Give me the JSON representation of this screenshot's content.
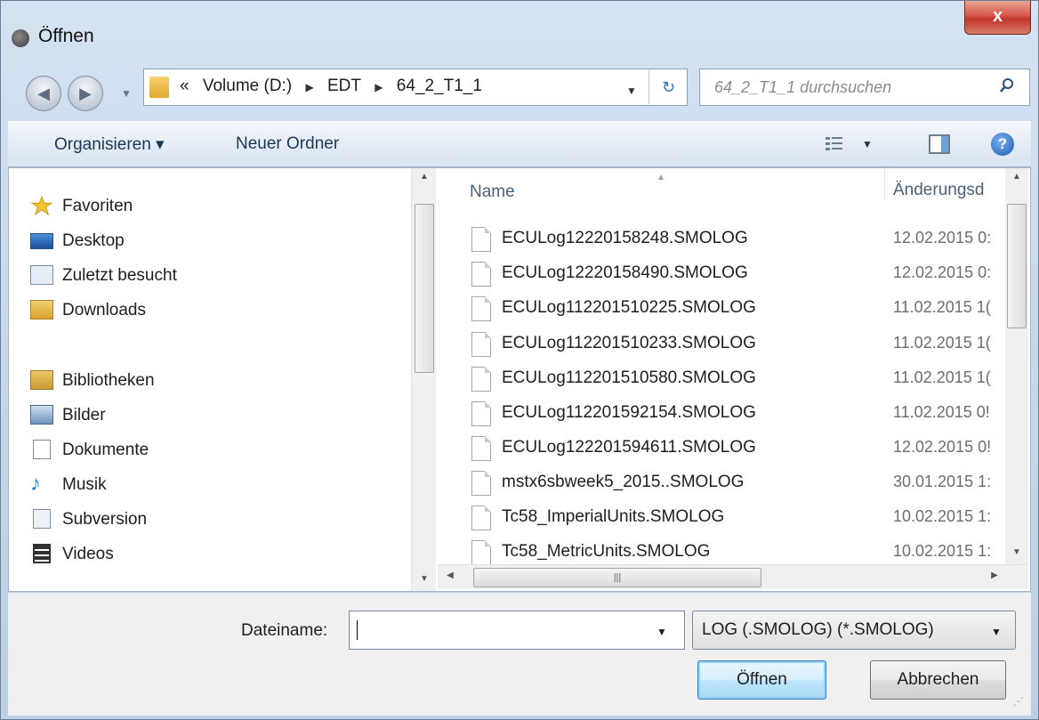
{
  "window": {
    "title": "Öffnen",
    "close_label": "x"
  },
  "nav": {
    "breadcrumb": [
      "«",
      "Volume (D:)",
      "EDT",
      "64_2_T1_1"
    ],
    "search_placeholder": "64_2_T1_1 durchsuchen"
  },
  "toolbar": {
    "organize": "Organisieren ▾",
    "new_folder": "Neuer Ordner",
    "help": "?"
  },
  "sidebar": {
    "favorites_header": "Favoriten",
    "favorites": [
      "Desktop",
      "Zuletzt besucht",
      "Downloads"
    ],
    "libraries_header": "Bibliotheken",
    "libraries": [
      "Bilder",
      "Dokumente",
      "Musik",
      "Subversion",
      "Videos"
    ]
  },
  "filelist": {
    "col_name": "Name",
    "col_date": "Änderungsd",
    "files": [
      {
        "name": "ECULog12220158248.SMOLOG",
        "date": "12.02.2015 0:"
      },
      {
        "name": "ECULog12220158490.SMOLOG",
        "date": "12.02.2015 0:"
      },
      {
        "name": "ECULog112201510225.SMOLOG",
        "date": "11.02.2015 1("
      },
      {
        "name": "ECULog112201510233.SMOLOG",
        "date": "11.02.2015 1("
      },
      {
        "name": "ECULog112201510580.SMOLOG",
        "date": "11.02.2015 1("
      },
      {
        "name": "ECULog112201592154.SMOLOG",
        "date": "11.02.2015 0!"
      },
      {
        "name": "ECULog122201594611.SMOLOG",
        "date": "12.02.2015 0!"
      },
      {
        "name": "mstx6sbweek5_2015..SMOLOG",
        "date": "30.01.2015 1:"
      },
      {
        "name": "Tc58_ImperialUnits.SMOLOG",
        "date": "10.02.2015 1:"
      },
      {
        "name": "Tc58_MetricUnits.SMOLOG",
        "date": "10.02.2015 1:"
      }
    ]
  },
  "footer": {
    "filename_label": "Dateiname:",
    "filename_value": "",
    "filetype": "LOG (.SMOLOG) (*.SMOLOG)",
    "open_button": "Öffnen",
    "cancel_button": "Abbrechen"
  }
}
